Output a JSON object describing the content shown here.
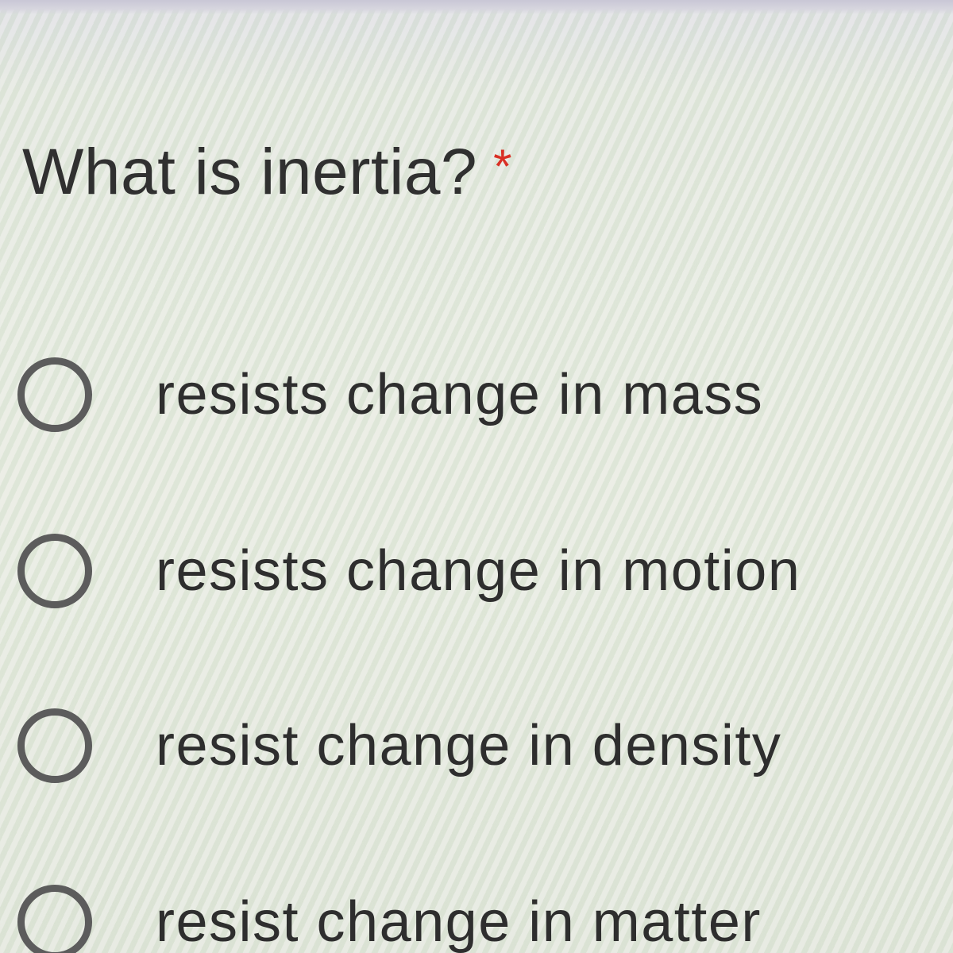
{
  "question": {
    "text": "What is inertia?",
    "required_marker": "*",
    "required_color": "#d93025"
  },
  "options": [
    {
      "label": "resists change in mass",
      "selected": false
    },
    {
      "label": "resists change in motion",
      "selected": false
    },
    {
      "label": "resist change in density",
      "selected": false
    },
    {
      "label": "resist change in matter",
      "selected": false
    }
  ]
}
